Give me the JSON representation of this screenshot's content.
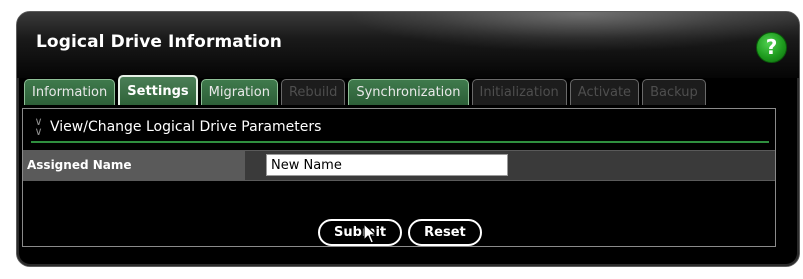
{
  "window": {
    "title": "Logical Drive Information",
    "help_label": "?"
  },
  "tabs": [
    {
      "label": "Information",
      "state": "enabled"
    },
    {
      "label": "Settings",
      "state": "active"
    },
    {
      "label": "Migration",
      "state": "enabled"
    },
    {
      "label": "Rebuild",
      "state": "disabled"
    },
    {
      "label": "Synchronization",
      "state": "enabled"
    },
    {
      "label": "Initialization",
      "state": "disabled"
    },
    {
      "label": "Activate",
      "state": "disabled"
    },
    {
      "label": "Backup",
      "state": "disabled"
    }
  ],
  "section": {
    "title": "View/Change Logical Drive Parameters",
    "icon": "double-chevron-down-icon"
  },
  "form": {
    "assigned_name_label": "Assigned Name",
    "assigned_name_value": "New Name"
  },
  "buttons": {
    "submit_label": "Submit",
    "reset_label": "Reset"
  },
  "colors": {
    "tab_green": "#2c5e37",
    "section_rule": "#2f8f3f",
    "help_green": "#1e9b1e"
  }
}
